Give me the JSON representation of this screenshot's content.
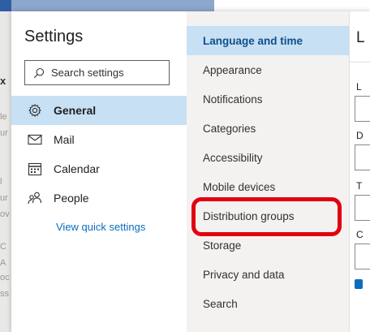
{
  "background": {
    "glyphs": [
      "x",
      "le",
      "ur",
      "l",
      "ur",
      "ov",
      "C",
      "A",
      "oc",
      "ss"
    ]
  },
  "settings": {
    "title": "Settings",
    "search": {
      "placeholder": "Search settings"
    },
    "nav": [
      {
        "label": "General",
        "icon": "gear-icon",
        "selected": true
      },
      {
        "label": "Mail",
        "icon": "mail-icon",
        "selected": false
      },
      {
        "label": "Calendar",
        "icon": "calendar-icon",
        "selected": false
      },
      {
        "label": "People",
        "icon": "people-icon",
        "selected": false
      }
    ],
    "quick_settings_link": "View quick settings"
  },
  "categories": [
    {
      "label": "Language and time",
      "selected": true
    },
    {
      "label": "Appearance",
      "selected": false
    },
    {
      "label": "Notifications",
      "selected": false
    },
    {
      "label": "Categories",
      "selected": false
    },
    {
      "label": "Accessibility",
      "selected": false
    },
    {
      "label": "Mobile devices",
      "selected": false
    },
    {
      "label": "Distribution groups",
      "selected": false,
      "highlighted": true
    },
    {
      "label": "Storage",
      "selected": false
    },
    {
      "label": "Privacy and data",
      "selected": false
    },
    {
      "label": "Search",
      "selected": false
    }
  ],
  "right_pane": {
    "header": "L",
    "labels": [
      "L",
      "D",
      "T",
      "C"
    ]
  },
  "colors": {
    "accent": "#0f6cbd",
    "selected_bg": "#c7e0f4",
    "highlight_border": "#e3000f"
  }
}
